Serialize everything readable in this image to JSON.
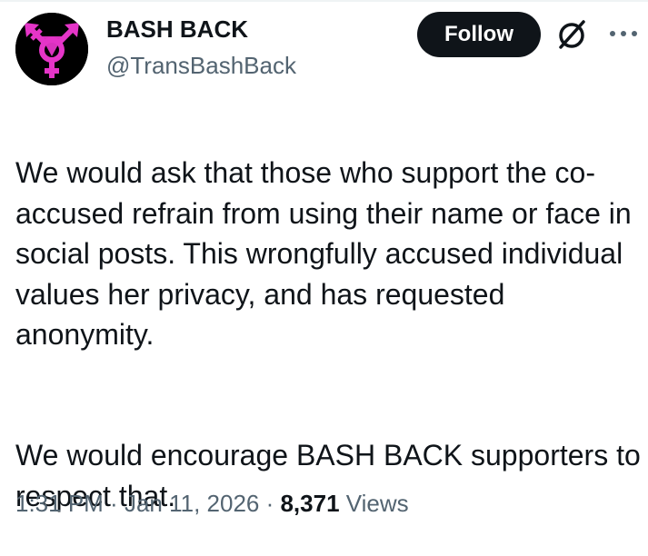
{
  "author": {
    "display_name": "BASH BACK",
    "handle": "@TransBashBack",
    "avatar_icon": "transgender-symbol-icon",
    "avatar_bg": "#000000",
    "avatar_accent": "#e535c8"
  },
  "actions": {
    "follow_label": "Follow",
    "grok_icon": "grok-icon",
    "more_icon": "more-options-icon"
  },
  "tweet": {
    "paragraphs": [
      "We would ask that those who support the co-accused refrain from using their name or face in social posts. This wrongfully accused individual values her privacy, and has requested anonymity.",
      "We would encourage BASH BACK supporters to respect that."
    ]
  },
  "meta": {
    "time": "1:31 PM",
    "separator": " · ",
    "date": "Jan 11, 2026",
    "views_count": "8,371",
    "views_label": "Views"
  },
  "colors": {
    "text_primary": "#0f1419",
    "text_secondary": "#536471",
    "button_bg": "#0f1419",
    "button_text": "#ffffff"
  }
}
